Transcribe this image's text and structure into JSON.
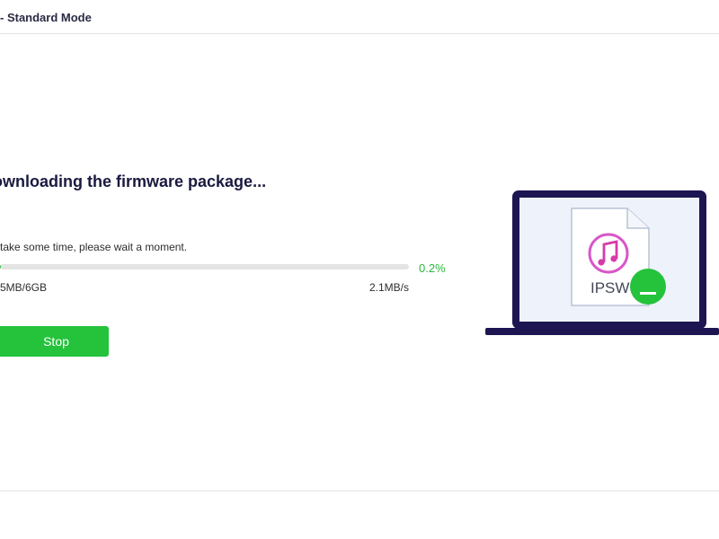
{
  "header": {
    "title": "- Standard Mode"
  },
  "main": {
    "title": "ownloading the firmware package...",
    "subtitle": "take some time, please wait a moment.",
    "progress": {
      "percent_label": "0.2%",
      "fraction": 0.002,
      "downloaded": "5MB/6GB",
      "speed": "2.1MB/s"
    },
    "stop_label": "Stop"
  },
  "illustration": {
    "file_label": "IPSW",
    "icons": [
      "laptop-icon",
      "music-note-icon",
      "download-icon"
    ]
  },
  "colors": {
    "accent": "#25c23c",
    "progress_text": "#2db83d",
    "laptop_frame": "#1c1552",
    "screen_bg": "#eef2fb"
  }
}
